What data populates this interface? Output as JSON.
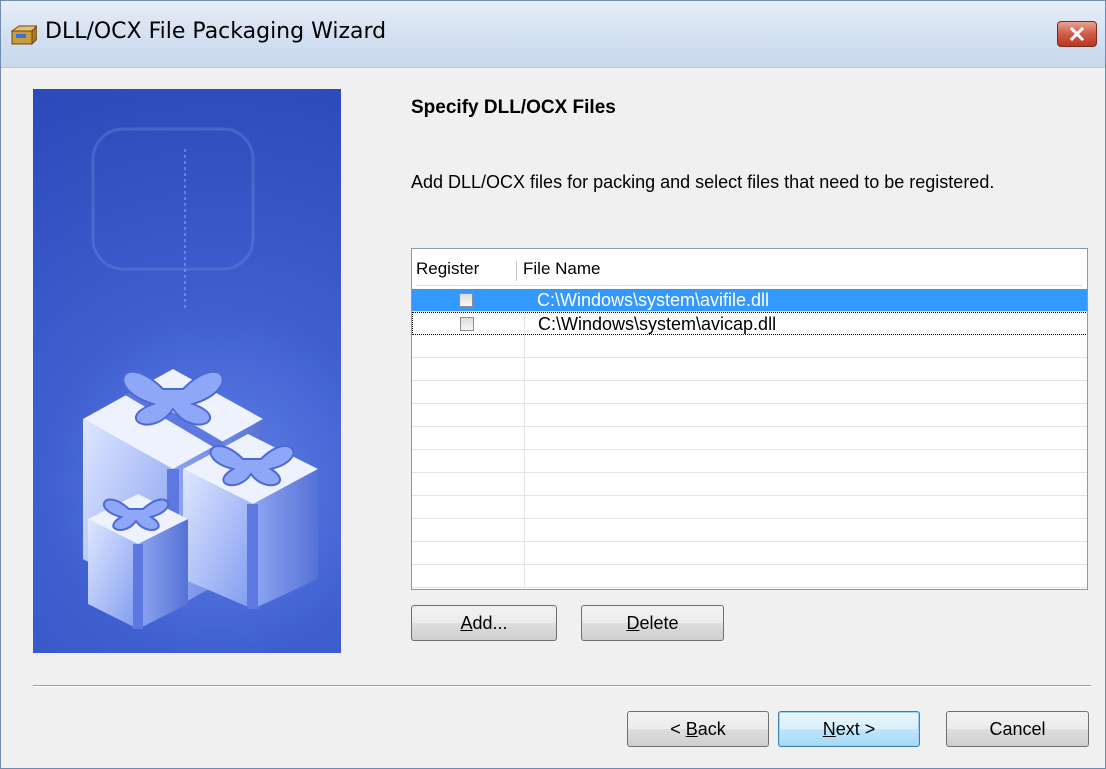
{
  "window": {
    "title": "DLL/OCX File Packaging Wizard",
    "close_icon": "close-icon",
    "app_icon": "package-icon"
  },
  "page": {
    "heading": "Specify DLL/OCX Files",
    "description": "Add DLL/OCX files for packing and select files that need to be registered."
  },
  "list": {
    "columns": {
      "register": "Register",
      "file_name": "File Name"
    },
    "rows": [
      {
        "registered": false,
        "file": "C:\\Windows\\system\\avifile.dll",
        "selected": true
      },
      {
        "registered": false,
        "file": "C:\\Windows\\system\\avicap.dll",
        "selected": false
      }
    ]
  },
  "buttons": {
    "add": {
      "mnemonic": "A",
      "rest": "dd..."
    },
    "delete": {
      "mnemonic": "D",
      "rest": "elete"
    },
    "back": {
      "prefix": "< ",
      "mnemonic": "B",
      "rest": "ack"
    },
    "next": {
      "mnemonic": "N",
      "rest": "ext >"
    },
    "cancel": "Cancel"
  },
  "colors": {
    "selection": "#3399ff",
    "banner": "#3f5fd0"
  }
}
